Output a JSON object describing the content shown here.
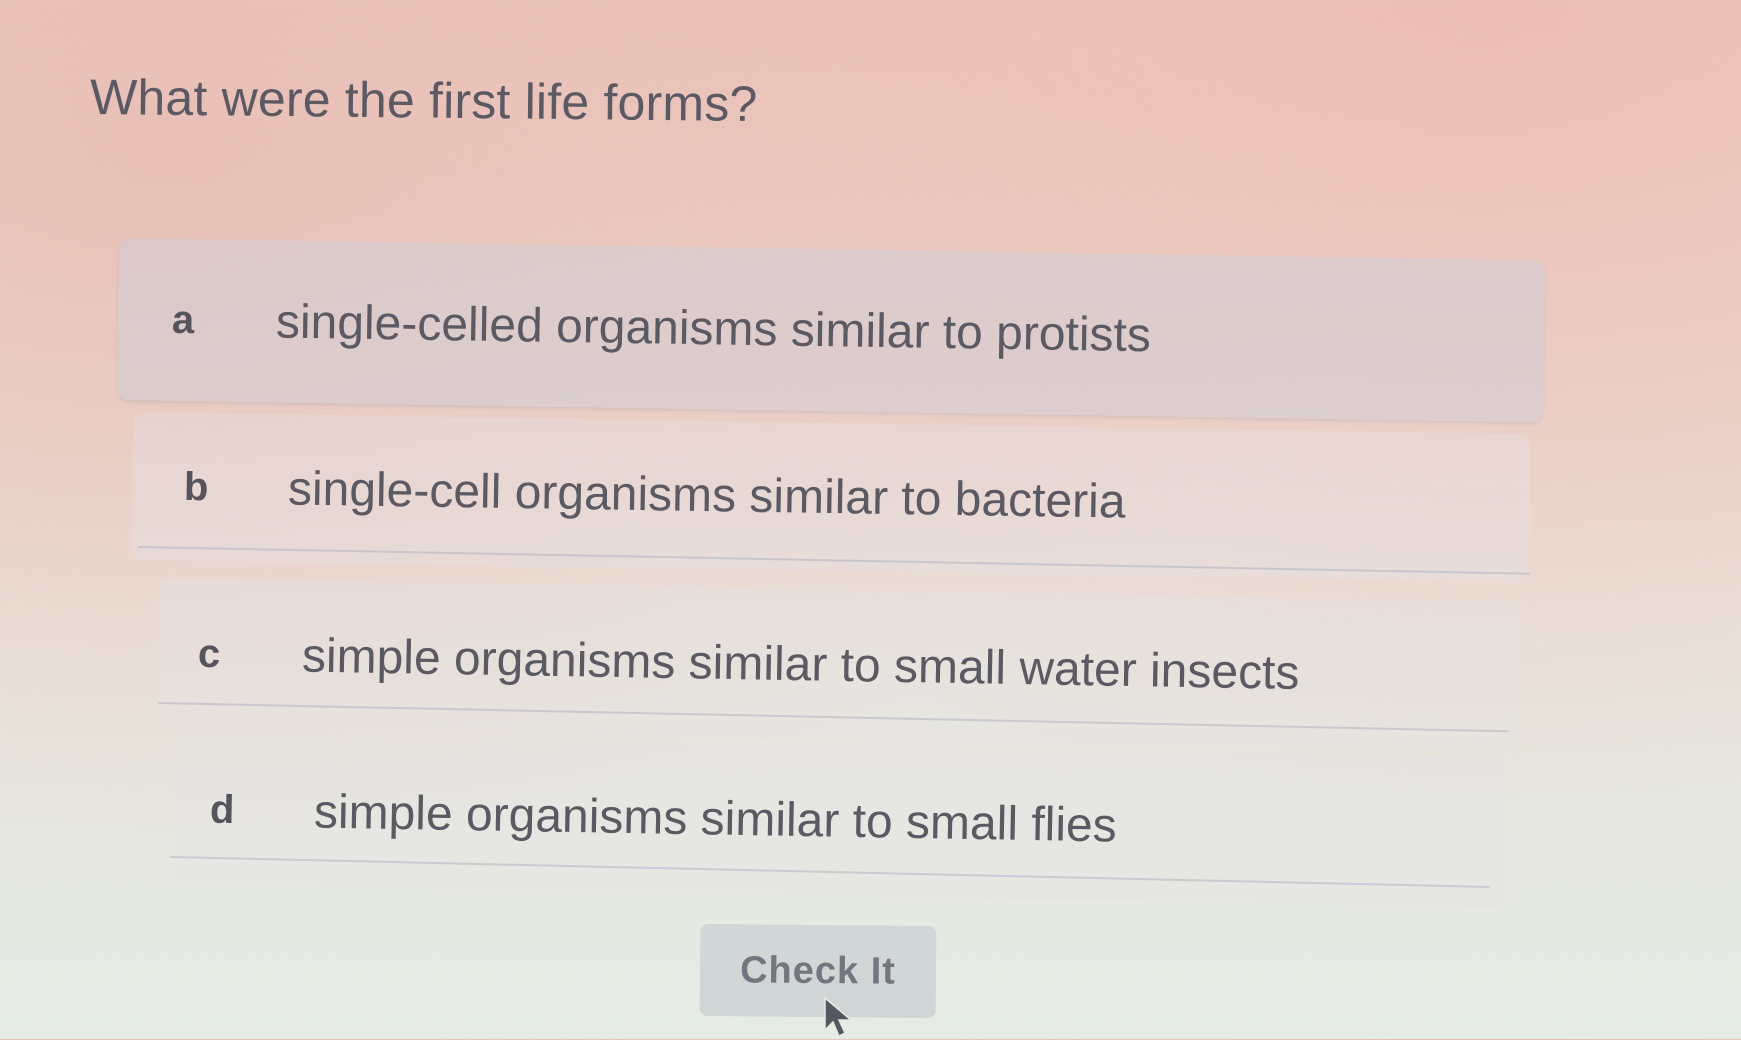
{
  "question": {
    "text": "What were the first life forms?"
  },
  "options": [
    {
      "letter": "a",
      "text": "single-celled organisms similar to protists"
    },
    {
      "letter": "b",
      "text": "single-cell organisms similar to bacteria"
    },
    {
      "letter": "c",
      "text": "simple organisms similar to small water insects"
    },
    {
      "letter": "d",
      "text": "simple organisms similar to small flies"
    }
  ],
  "actions": {
    "check_label": "Check It"
  },
  "icons": {
    "cursor": "mouse-pointer-icon"
  },
  "colors": {
    "text": "#5b5a63",
    "selected_option_bg": "#d0cdd6",
    "button_bg": "#cdd2d4",
    "button_text": "#74767f"
  }
}
